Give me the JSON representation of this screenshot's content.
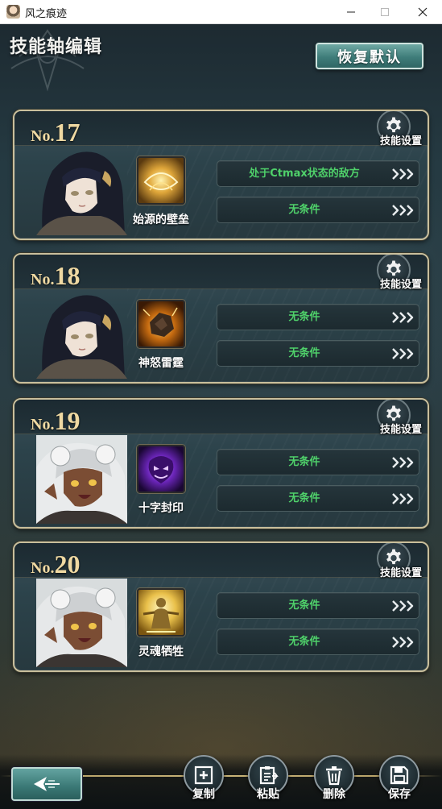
{
  "window": {
    "title": "风之痕迹",
    "icon": "app-avatar-icon",
    "controls": [
      "minimize-icon",
      "maximize-icon",
      "close-icon"
    ]
  },
  "page": {
    "title": "技能轴编辑",
    "reset_label": "恢复默认"
  },
  "theme": {
    "condition_text_color": "#4fd16a",
    "number_color": "#efd9a2",
    "card_border": "#c9bf9c"
  },
  "gear_label": "技能设置",
  "no_label": "No.",
  "cards": [
    {
      "number": "17",
      "portrait": "dark-haired-girl-portrait",
      "skill_icon": "golden-barrier-skill-icon",
      "skill_name": "始源的壁垒",
      "conditions": [
        {
          "text": "处于Ctmax状态的敌方"
        },
        {
          "text": "无条件"
        }
      ]
    },
    {
      "number": "18",
      "portrait": "dark-haired-girl-portrait",
      "skill_icon": "thunder-rock-skill-icon",
      "skill_name": "神怒雷霆",
      "conditions": [
        {
          "text": "无条件"
        },
        {
          "text": "无条件"
        }
      ]
    },
    {
      "number": "19",
      "portrait": "white-haired-girl-portrait",
      "skill_icon": "purple-seal-skill-icon",
      "skill_name": "十字封印",
      "conditions": [
        {
          "text": "无条件"
        },
        {
          "text": "无条件"
        }
      ]
    },
    {
      "number": "20",
      "portrait": "white-haired-girl-portrait",
      "skill_icon": "golden-warrior-skill-icon",
      "skill_name": "灵魂牺牲",
      "conditions": [
        {
          "text": "无条件"
        },
        {
          "text": "无条件"
        }
      ]
    }
  ],
  "actions": [
    {
      "label": "复制",
      "icon": "copy-icon"
    },
    {
      "label": "粘贴",
      "icon": "paste-icon"
    },
    {
      "label": "删除",
      "icon": "trash-icon"
    },
    {
      "label": "保存",
      "icon": "save-icon"
    }
  ],
  "back_button_icon": "back-arrow-icon"
}
